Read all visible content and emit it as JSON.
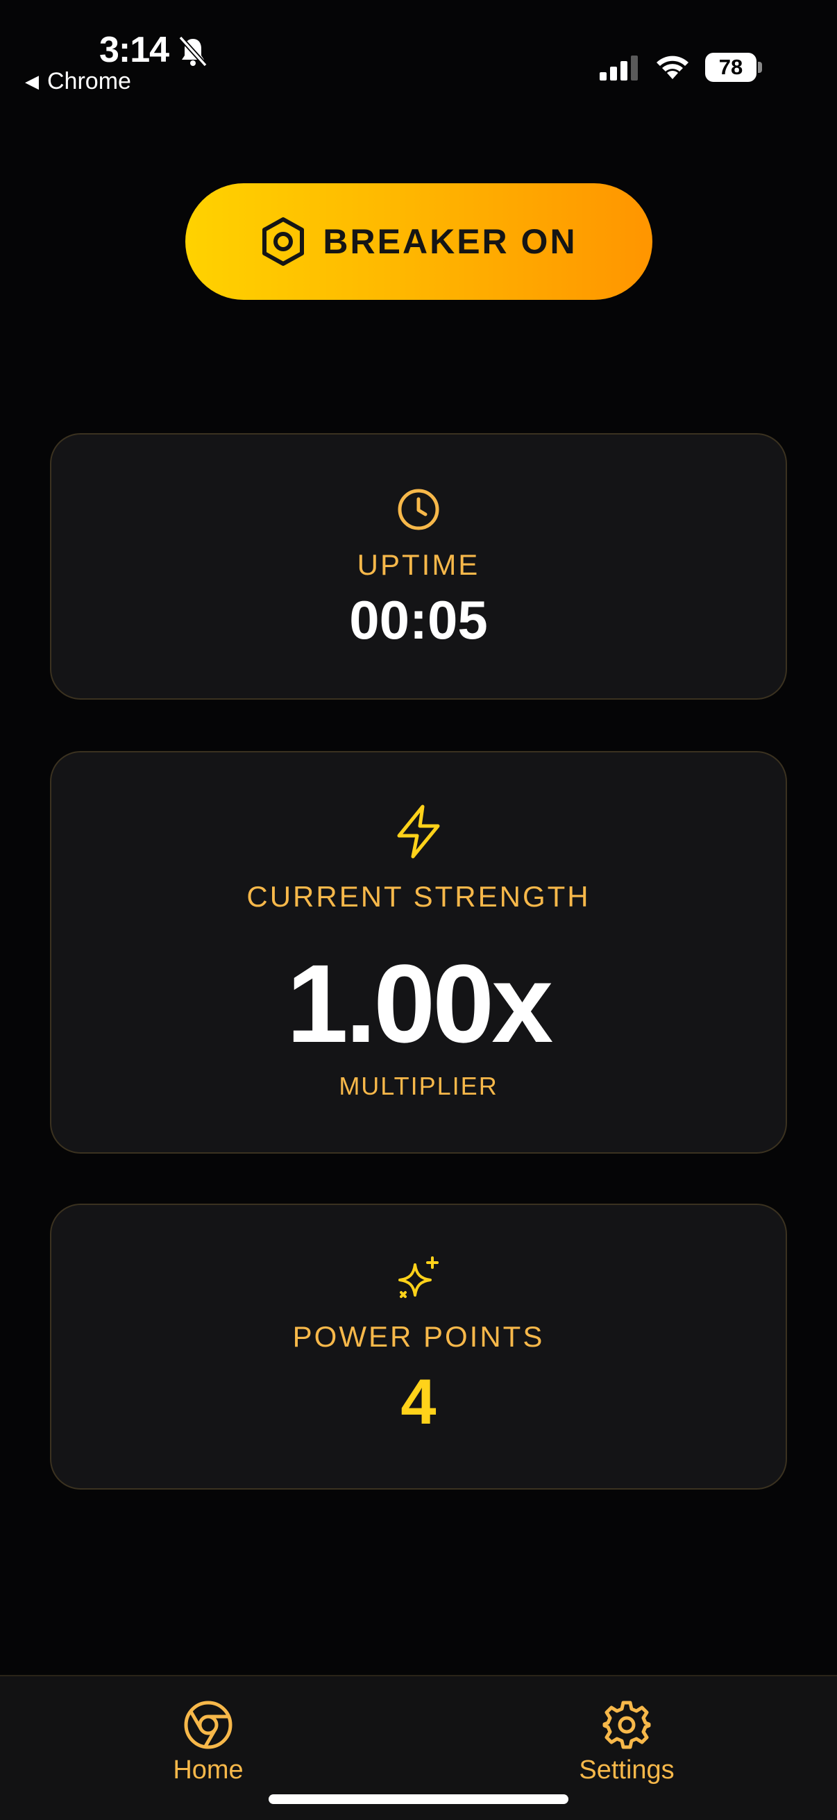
{
  "status_bar": {
    "time": "3:14",
    "back_app": "Chrome",
    "battery": "78"
  },
  "breaker": {
    "label": "BREAKER ON",
    "icon": "hexagon-nut-icon",
    "gradient_start": "#ffd200",
    "gradient_end": "#ff9500"
  },
  "cards": {
    "uptime": {
      "icon": "clock-icon",
      "label": "UPTIME",
      "value": "00:05"
    },
    "strength": {
      "icon": "lightning-bolt-icon",
      "label": "CURRENT STRENGTH",
      "value": "1.00x",
      "sub": "MULTIPLIER"
    },
    "points": {
      "icon": "sparkles-icon",
      "label": "POWER POINTS",
      "value": "4"
    }
  },
  "nav": {
    "home": {
      "label": "Home",
      "icon": "chrome-logo-icon"
    },
    "settings": {
      "label": "Settings",
      "icon": "gear-icon"
    }
  },
  "colors": {
    "accent": "#f7b84a",
    "highlight": "#ffd21a",
    "background": "#050506",
    "card": "#141416"
  }
}
